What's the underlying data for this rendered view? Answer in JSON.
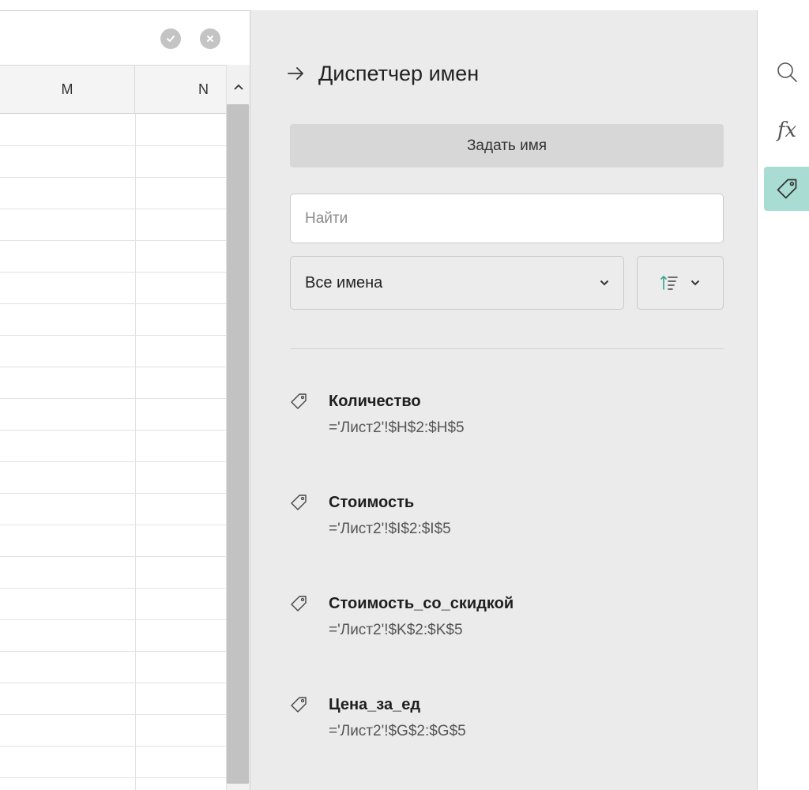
{
  "spreadsheet": {
    "columns": [
      "M",
      "N"
    ]
  },
  "panel": {
    "title": "Диспетчер имен",
    "define_button_label": "Задать имя",
    "search_placeholder": "Найти",
    "filter_value": "Все имена",
    "names": [
      {
        "label": "Количество",
        "ref": "='Лист2'!$H$2:$H$5"
      },
      {
        "label": "Стоимость",
        "ref": "='Лист2'!$I$2:$I$5"
      },
      {
        "label": "Стоимость_со_скидкой",
        "ref": "='Лист2'!$K$2:$K$5"
      },
      {
        "label": "Цена_за_ед",
        "ref": "='Лист2'!$G$2:$G$5"
      }
    ]
  },
  "side_toolbar": {
    "fx_label": "fx",
    "active_item": "names"
  },
  "colors": {
    "accent": "#2fa58e",
    "active_tab_bg": "#a9dcd2",
    "panel_bg": "#ebebeb"
  },
  "icons": [
    "confirm-icon",
    "cancel-icon",
    "scroll-up-icon",
    "arrow-right-icon",
    "chevron-down-icon",
    "sort-icon",
    "tag-icon",
    "search-icon"
  ]
}
